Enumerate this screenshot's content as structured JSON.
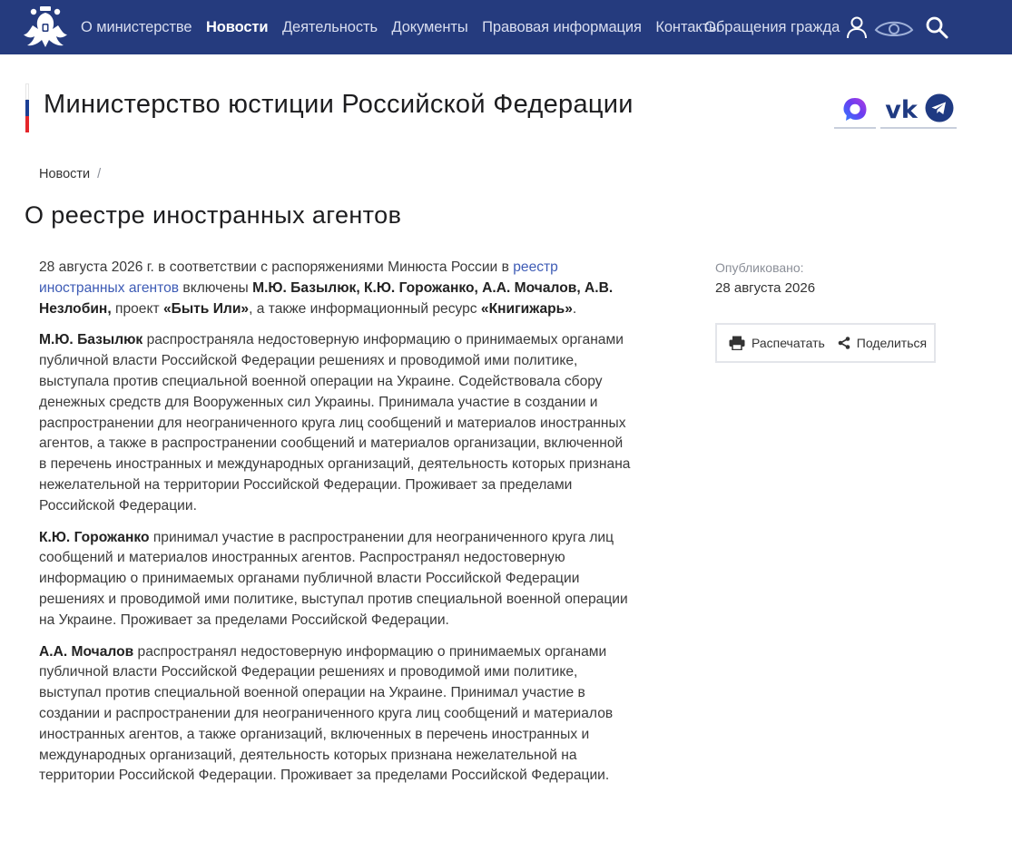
{
  "nav": {
    "items": [
      {
        "label": "О министерстве",
        "active": false
      },
      {
        "label": "Новости",
        "active": true
      },
      {
        "label": "Деятельность",
        "active": false
      },
      {
        "label": "Документы",
        "active": false
      },
      {
        "label": "Правовая информация",
        "active": false
      },
      {
        "label": "Контакты",
        "active": false
      }
    ],
    "clipped_item": "Обращения граждан",
    "icons": [
      "emblem-icon",
      "user-icon",
      "eye-icon",
      "search-icon"
    ]
  },
  "header": {
    "site_title": "Министерство юстиции Российской Федерации",
    "flag_colors": [
      "#ffffff",
      "#1c3f94",
      "#e4262b"
    ],
    "social_icons": [
      "max-icon",
      "vk-icon",
      "telegram-icon"
    ]
  },
  "breadcrumb": {
    "item": "Новости",
    "separator": "/"
  },
  "article": {
    "title": "О реестре иностранных агентов",
    "p1": {
      "t1": "28 августа 2026 г. в соответствии с распоряжениями Минюста России в ",
      "link": "реестр иностранных агентов",
      "t2": " включены ",
      "names": "М.Ю. Базылюк, К.Ю. Горожанко, А.А. Мочалов, А.В. Незлобин,",
      "t3": " проект ",
      "project": "«Быть Или»",
      "t4": ", а также информационный ресурс ",
      "resource": "«Книгижарь»",
      "t5": "."
    },
    "p2": {
      "name": "М.Ю. Базылюк",
      "text": " распространяла недостоверную информацию о принимаемых органами публичной власти Российской Федерации решениях и проводимой ими политике, выступала против специальной военной операции на Украине. Содействовала сбору денежных средств для Вооруженных сил Украины. Принимала участие в создании и распространении для неограниченного круга лиц сообщений и материалов иностранных агентов, а также в распространении сообщений и материалов организации, включенной в перечень иностранных и международных организаций, деятельность которых признана нежелательной на территории Российской Федерации. Проживает за пределами Российской Федерации."
    },
    "p3": {
      "name": "К.Ю. Горожанко",
      "text": " принимал участие в распространении для неограниченного круга лиц сообщений и материалов иностранных агентов. Распространял недостоверную информацию о принимаемых органами публичной власти Российской Федерации решениях и проводимой ими политике, выступал против специальной военной операции на Украине. Проживает за пределами Российской Федерации."
    },
    "p4": {
      "name": "А.А. Мочалов",
      "text": " распространял недостоверную информацию о принимаемых органами публичной власти Российской Федерации решениях и проводимой ими политике, выступал против специальной военной операции на Украине. Принимал участие в создании и распространении для неограниченного круга лиц сообщений и материалов иностранных агентов, а также организаций, включенных в перечень иностранных и международных организаций, деятельность которых признана нежелательной на территории Российской Федерации. Проживает за пределами Российской Федерации."
    }
  },
  "sidebar": {
    "published_label": "Опубликовано:",
    "published_date": "28 августа 2026",
    "print_label": "Распечатать",
    "share_label": "Поделиться"
  },
  "colors": {
    "nav_bg": "#253b7e",
    "link": "#3d5bb5",
    "telegram": "#1f3a82"
  }
}
